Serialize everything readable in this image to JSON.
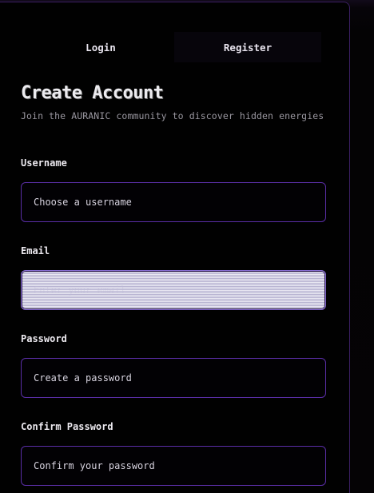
{
  "tabs": {
    "login": "Login",
    "register": "Register"
  },
  "form": {
    "title": "Create Account",
    "subtitle": "Join the AURANIC community to discover hidden energies",
    "username": {
      "label": "Username",
      "placeholder": "Choose a username"
    },
    "email": {
      "label": "Email",
      "placeholder": "Enter your email"
    },
    "password": {
      "label": "Password",
      "placeholder": "Create a password"
    },
    "confirm": {
      "label": "Confirm Password",
      "placeholder": "Confirm your password"
    }
  },
  "colors": {
    "accent": "#5a2ea6",
    "background": "#010101",
    "text": "#ece9ef"
  }
}
